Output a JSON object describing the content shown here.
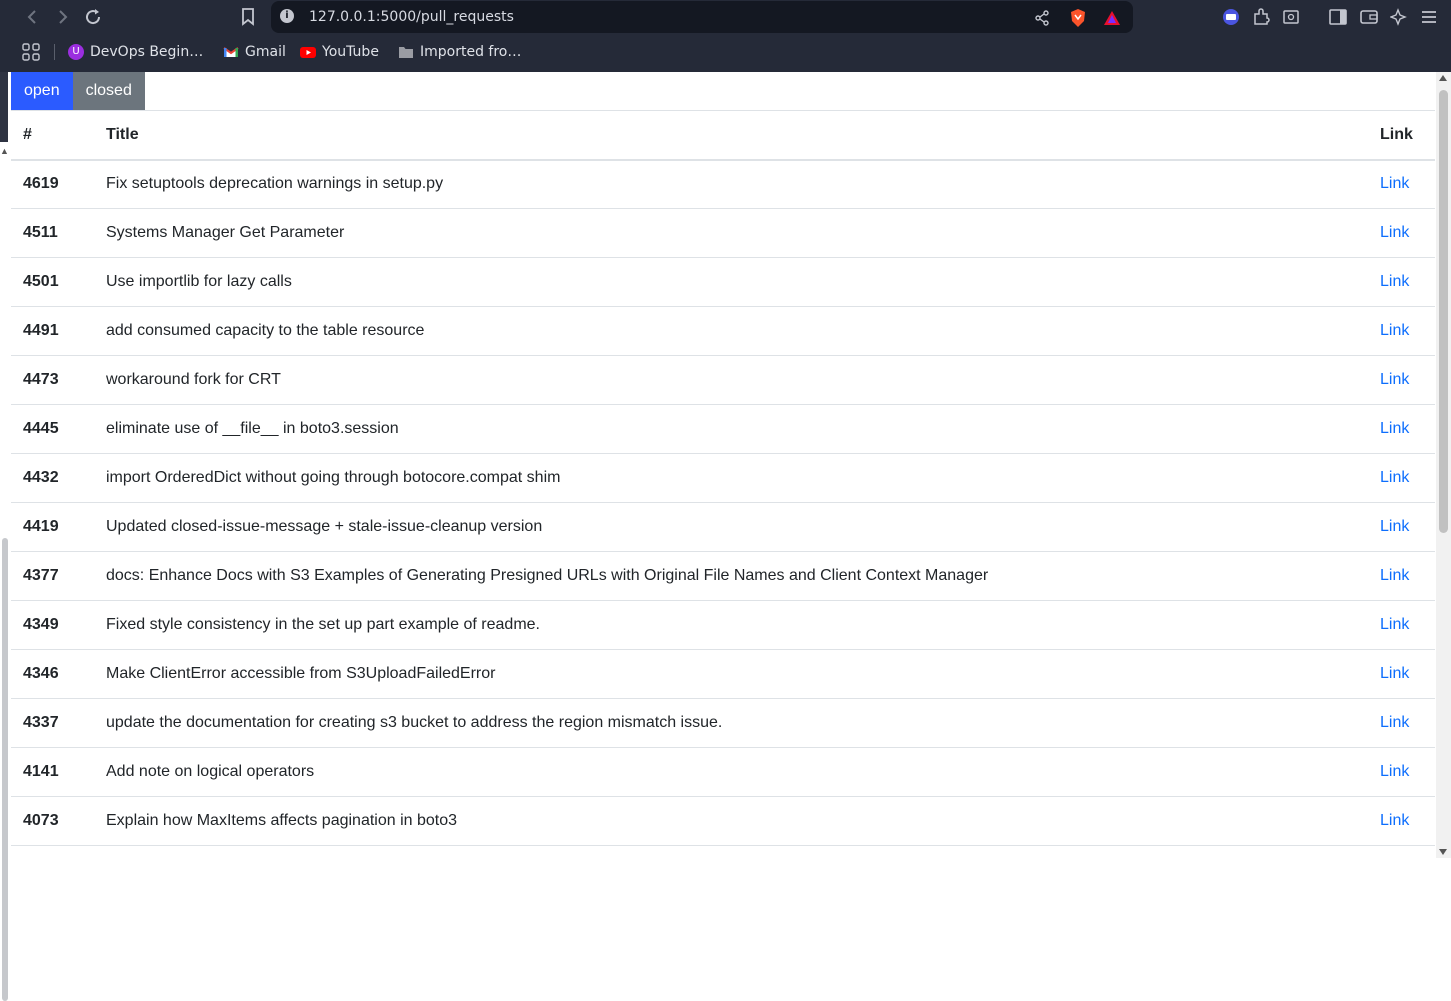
{
  "browser": {
    "url": "127.0.0.1:5000/pull_requests",
    "bookmarks": [
      {
        "label": "DevOps Begin…",
        "icon": "devops-icon"
      },
      {
        "label": "Gmail",
        "icon": "gmail-icon"
      },
      {
        "label": "YouTube",
        "icon": "youtube-icon"
      },
      {
        "label": "Imported fro…",
        "icon": "folder-icon"
      }
    ]
  },
  "tabs": {
    "open_label": "open",
    "closed_label": "closed"
  },
  "table": {
    "headers": {
      "number": "#",
      "title": "Title",
      "link": "Link"
    },
    "rows": [
      {
        "number": "4619",
        "title": "Fix setuptools deprecation warnings in setup.py",
        "link": "Link"
      },
      {
        "number": "4511",
        "title": "Systems Manager Get Parameter",
        "link": "Link"
      },
      {
        "number": "4501",
        "title": "Use importlib for lazy calls",
        "link": "Link"
      },
      {
        "number": "4491",
        "title": "add consumed capacity to the table resource",
        "link": "Link"
      },
      {
        "number": "4473",
        "title": "workaround fork for CRT",
        "link": "Link"
      },
      {
        "number": "4445",
        "title": "eliminate use of __file__ in boto3.session",
        "link": "Link"
      },
      {
        "number": "4432",
        "title": "import OrderedDict without going through botocore.compat shim",
        "link": "Link"
      },
      {
        "number": "4419",
        "title": "Updated closed-issue-message + stale-issue-cleanup version",
        "link": "Link"
      },
      {
        "number": "4377",
        "title": "docs: Enhance Docs with S3 Examples of Generating Presigned URLs with Original File Names and Client Context Manager",
        "link": "Link"
      },
      {
        "number": "4349",
        "title": "Fixed style consistency in the set up part example of readme.",
        "link": "Link"
      },
      {
        "number": "4346",
        "title": "Make ClientError accessible from S3UploadFailedError",
        "link": "Link"
      },
      {
        "number": "4337",
        "title": "update the documentation for creating s3 bucket to address the region mismatch issue.",
        "link": "Link"
      },
      {
        "number": "4141",
        "title": "Add note on logical operators",
        "link": "Link"
      },
      {
        "number": "4073",
        "title": "Explain how MaxItems affects pagination in boto3",
        "link": "Link"
      }
    ]
  },
  "colors": {
    "open_tab": "#2b5bff",
    "closed_tab": "#6c757d",
    "link": "#0d6efd"
  }
}
